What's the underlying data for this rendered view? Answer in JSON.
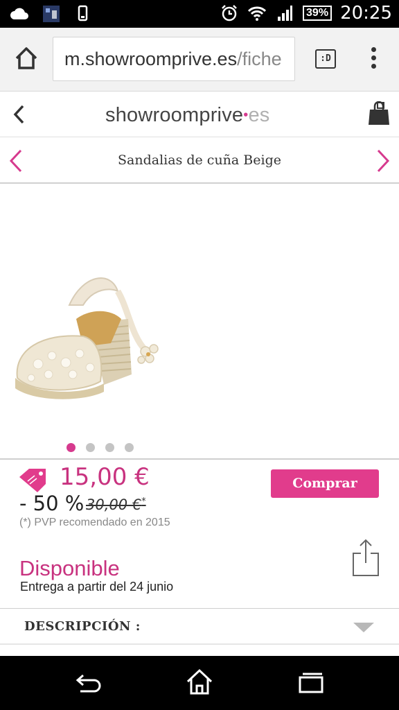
{
  "status_bar": {
    "time": "20:25",
    "battery": "39%",
    "icons": [
      "cloud-icon",
      "notification-icon",
      "phone-icon",
      "alarm-icon",
      "wifi-icon",
      "signal-icon",
      "battery-icon"
    ]
  },
  "browser": {
    "url_main": "m.showroomprive.es",
    "url_rest": "/fiche",
    "tab_label": ":D"
  },
  "site": {
    "logo_text": "showroomprive",
    "logo_dot": "•",
    "logo_tld": "es"
  },
  "product": {
    "title": "Sandalias de cuña Beige",
    "image_count": 4,
    "active_image": 0,
    "price": "15,00 €",
    "discount": "- 50 %",
    "old_price": "30,00 €",
    "old_price_mark": "*",
    "pvp_note": "(*) PVP recomendado en 2015",
    "buy_label": "Comprar",
    "availability": "Disponible",
    "delivery": "Entrega a partir del 24 junio",
    "description_label": "DESCRIPCIÓN :"
  },
  "colors": {
    "accent": "#e13c8c",
    "accent_text": "#c8327f"
  }
}
